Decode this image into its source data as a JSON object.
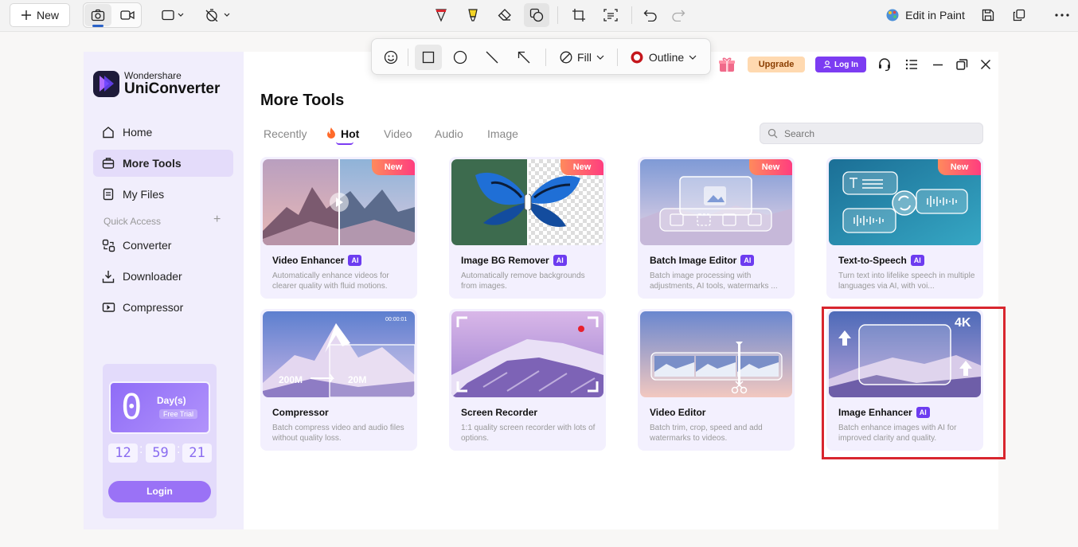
{
  "snip_toolbar": {
    "new_label": "New",
    "edit_in_paint": "Edit in Paint"
  },
  "shape_toolbar": {
    "fill_label": "Fill",
    "outline_label": "Outline"
  },
  "app": {
    "brand_line1": "Wondershare",
    "brand_line2": "UniConverter",
    "upgrade_label": "Upgrade",
    "login_label": "Log In",
    "nav": [
      {
        "label": "Home"
      },
      {
        "label": "More Tools"
      },
      {
        "label": "My Files"
      }
    ],
    "quick_access_label": "Quick Access",
    "quick_access_add": "+",
    "quick_nav": [
      {
        "label": "Converter"
      },
      {
        "label": "Downloader"
      },
      {
        "label": "Compressor"
      }
    ],
    "trial": {
      "days_number": "0",
      "days_label": "Day(s)",
      "free_trial": "Free Trial",
      "hours": "12",
      "minutes": "59",
      "seconds": "21",
      "colon": ":",
      "login_button": "Login"
    },
    "main": {
      "title": "More Tools",
      "tabs": [
        "Recently",
        "Hot",
        "Video",
        "Audio",
        "Image"
      ],
      "active_tab": "Hot",
      "search_placeholder": "Search"
    },
    "cards": [
      {
        "title": "Video Enhancer",
        "desc": "Automatically enhance videos for clearer quality with fluid motions.",
        "ai": "AI",
        "badge": "New"
      },
      {
        "title": "Image BG Remover",
        "desc": "Automatically remove backgrounds from images.",
        "ai": "AI",
        "badge": "New"
      },
      {
        "title": "Batch Image Editor",
        "desc": "Batch image processing with adjustments, AI tools, watermarks ...",
        "ai": "AI",
        "badge": "New"
      },
      {
        "title": "Text-to-Speech",
        "desc": "Turn text into lifelike speech in multiple languages via AI, with voi...",
        "ai": "AI",
        "badge": "New"
      },
      {
        "title": "Compressor",
        "desc": "Batch compress video and audio files without quality loss.",
        "size_from": "200M",
        "size_to": "20M",
        "timecode": "00:00:01"
      },
      {
        "title": "Screen Recorder",
        "desc": "1:1 quality screen recorder with lots of options."
      },
      {
        "title": "Video Editor",
        "desc": "Batch trim, crop, speed and add watermarks to videos."
      },
      {
        "title": "Image Enhancer",
        "desc": "Batch enhance images with AI for improved clarity and quality.",
        "ai": "AI",
        "badge_4k": "4K"
      }
    ]
  },
  "colors": {
    "accent_purple": "#6d3cf0",
    "highlight_red": "#d8262e",
    "new_badge": "#ff4f72"
  }
}
